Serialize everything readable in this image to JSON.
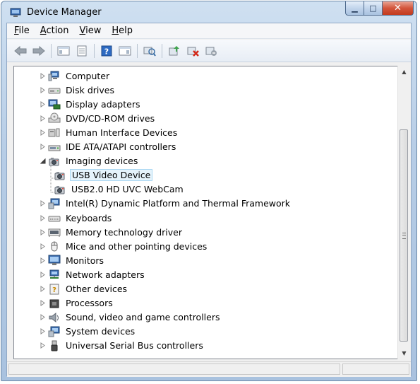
{
  "window": {
    "title": "Device Manager"
  },
  "caption": {
    "minimize": "▁",
    "maximize": "□",
    "close": "✕"
  },
  "menu": [
    {
      "accel": "F",
      "rest": "ile"
    },
    {
      "accel": "A",
      "rest": "ction"
    },
    {
      "accel": "V",
      "rest": "iew"
    },
    {
      "accel": "H",
      "rest": "elp"
    }
  ],
  "toolbar": {
    "icons": [
      "back-icon",
      "forward-icon",
      "show-hide-console-tree-icon",
      "properties-icon",
      "help-icon",
      "action-pane-icon",
      "scan-hardware-icon",
      "update-driver-icon",
      "disable-device-icon",
      "uninstall-device-icon"
    ]
  },
  "tree": {
    "items": [
      {
        "label": "Computer",
        "icon": "computer-icon",
        "level": 0,
        "state": "collapsed"
      },
      {
        "label": "Disk drives",
        "icon": "disk-drive-icon",
        "level": 0,
        "state": "collapsed"
      },
      {
        "label": "Display adapters",
        "icon": "display-adapter-icon",
        "level": 0,
        "state": "collapsed"
      },
      {
        "label": "DVD/CD-ROM drives",
        "icon": "dvd-drive-icon",
        "level": 0,
        "state": "collapsed"
      },
      {
        "label": "Human Interface Devices",
        "icon": "hid-icon",
        "level": 0,
        "state": "collapsed"
      },
      {
        "label": "IDE ATA/ATAPI controllers",
        "icon": "ide-controller-icon",
        "level": 0,
        "state": "collapsed"
      },
      {
        "label": "Imaging devices",
        "icon": "imaging-device-icon",
        "level": 0,
        "state": "expanded"
      },
      {
        "label": "USB Video Device",
        "icon": "camera-icon",
        "level": 1,
        "state": "leaf",
        "selected": true
      },
      {
        "label": "USB2.0 HD UVC WebCam",
        "icon": "camera-icon",
        "level": 1,
        "state": "leaf"
      },
      {
        "label": "Intel(R) Dynamic Platform and Thermal Framework",
        "icon": "system-device-icon",
        "level": 0,
        "state": "collapsed"
      },
      {
        "label": "Keyboards",
        "icon": "keyboard-icon",
        "level": 0,
        "state": "collapsed"
      },
      {
        "label": "Memory technology driver",
        "icon": "memory-icon",
        "level": 0,
        "state": "collapsed"
      },
      {
        "label": "Mice and other pointing devices",
        "icon": "mouse-icon",
        "level": 0,
        "state": "collapsed"
      },
      {
        "label": "Monitors",
        "icon": "monitor-icon",
        "level": 0,
        "state": "collapsed"
      },
      {
        "label": "Network adapters",
        "icon": "network-adapter-icon",
        "level": 0,
        "state": "collapsed"
      },
      {
        "label": "Other devices",
        "icon": "unknown-device-icon",
        "level": 0,
        "state": "collapsed"
      },
      {
        "label": "Processors",
        "icon": "processor-icon",
        "level": 0,
        "state": "collapsed"
      },
      {
        "label": "Sound, video and game controllers",
        "icon": "sound-icon",
        "level": 0,
        "state": "collapsed"
      },
      {
        "label": "System devices",
        "icon": "system-device-icon",
        "level": 0,
        "state": "collapsed"
      },
      {
        "label": "Universal Serial Bus controllers",
        "icon": "usb-icon",
        "level": 0,
        "state": "collapsed"
      }
    ]
  },
  "colors": {
    "selection_bg": "#e5f3fb",
    "selection_border": "#a9d7f3",
    "frame": "#b7cde6"
  }
}
